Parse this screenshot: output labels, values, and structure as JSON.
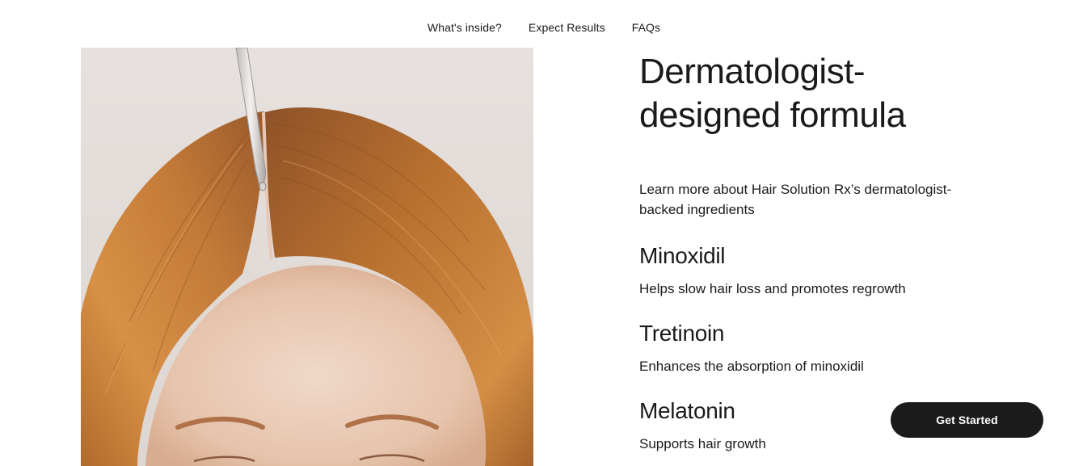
{
  "nav": {
    "items": [
      {
        "label": "What's inside?"
      },
      {
        "label": "Expect Results"
      },
      {
        "label": "FAQs"
      }
    ]
  },
  "hero": {
    "image_semantic": "woman-hair-part-dropper-photo"
  },
  "content": {
    "headline_line1": "Dermatologist-",
    "headline_line2": "designed formula",
    "intro": "Learn more about Hair Solution Rx’s dermatologist-backed ingredients",
    "ingredients": [
      {
        "name": "Minoxidil",
        "description": "Helps slow hair loss and promotes regrowth"
      },
      {
        "name": "Tretinoin",
        "description": "Enhances the absorption of minoxidil"
      },
      {
        "name": "Melatonin",
        "description": "Supports hair growth"
      }
    ]
  },
  "cta": {
    "label": "Get Started"
  },
  "colors": {
    "text": "#1a1a1a",
    "button_bg": "#1b1b1b",
    "button_text": "#ffffff",
    "background": "#ffffff",
    "hair": "#b86a2e"
  }
}
